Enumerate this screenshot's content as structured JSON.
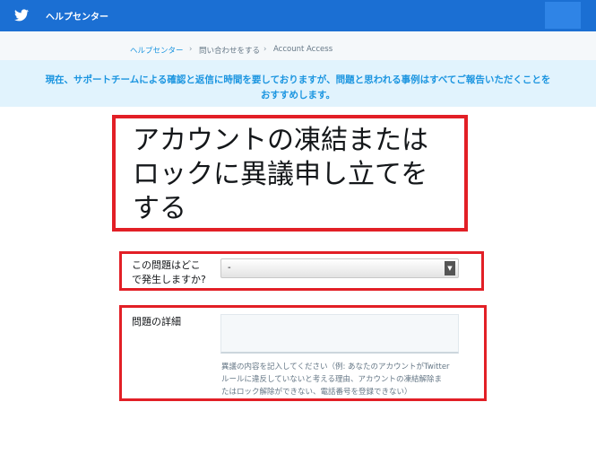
{
  "header": {
    "title": "ヘルプセンター",
    "logo_icon": "twitter-bird-icon",
    "brand_color": "#1b6fd3"
  },
  "breadcrumb": {
    "items": [
      "ヘルプセンター",
      "問い合わせをする",
      "Account Access"
    ],
    "separator": "›"
  },
  "notice": {
    "lines": [
      "現在、サポートチームによる確認と返信に時間を要しておりますが、問題と思われる事例はすべてご報告いただくことを",
      "おすすめします。"
    ]
  },
  "form": {
    "title_lines": [
      "アカウントの凍結または",
      "ロックに異議申し立てを",
      "する"
    ],
    "location_label_lines": [
      "この問題はどこ",
      "で発生しますか?"
    ],
    "location_value": "-",
    "details_label": "問題の詳細",
    "details_value": "",
    "details_help_lines": [
      "異議の内容を記入してください（例: あなたのアカウントがTwitter",
      "ルールに違反していないと考える理由、アカウントの凍結解除ま",
      "たはロック解除ができない、電話番号を登録できない）"
    ]
  },
  "highlight_color": "#e21f26"
}
